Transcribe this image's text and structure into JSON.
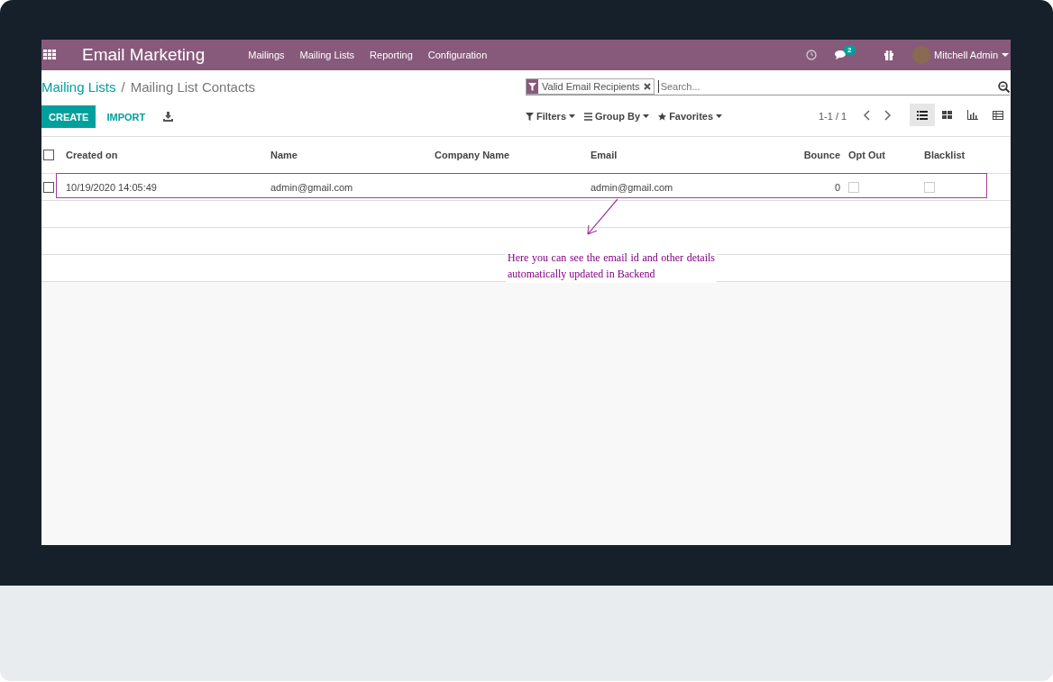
{
  "navbar": {
    "app_title": "Email Marketing",
    "menu": [
      "Mailings",
      "Mailing Lists",
      "Reporting",
      "Configuration"
    ],
    "messages_count": "2",
    "user": "Mitchell Admin"
  },
  "breadcrumb": {
    "parent": "Mailing Lists",
    "separator": "/",
    "current": "Mailing List Contacts"
  },
  "buttons": [
    "CREATE",
    "IMPORT"
  ],
  "search": {
    "facet": "Valid Email Recipients",
    "placeholder": "Search..."
  },
  "search_options": [
    "Filters",
    "Group By",
    "Favorites"
  ],
  "pager": "1-1 / 1",
  "views": [
    {
      "kind": "list",
      "selected": true
    },
    {
      "kind": "kanban",
      "selected": false
    },
    {
      "kind": "graph",
      "selected": false
    },
    {
      "kind": "pivot",
      "selected": false
    }
  ],
  "table": {
    "columns": [
      "Created on",
      "Name",
      "Company Name",
      "Email",
      "Bounce",
      "Opt Out",
      "Blacklist"
    ],
    "all_checked": false,
    "rows": [
      {
        "checked": false,
        "created_on": "10/19/2020 14:05:49",
        "name": "admin@gmail.com",
        "email": "admin@gmail.com",
        "bounce": "0",
        "opt_out": false,
        "blacklist": false
      }
    ]
  },
  "annotation": "Here you can see the email id and other details automatically updated in Backend"
}
